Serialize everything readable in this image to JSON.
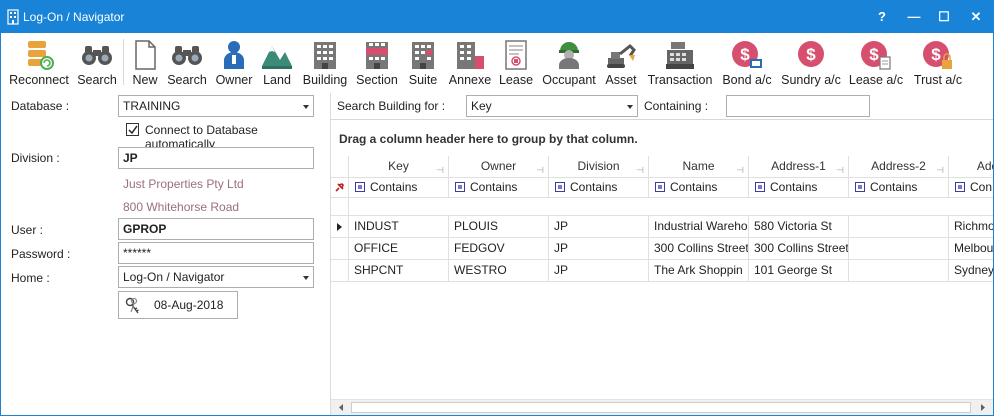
{
  "window": {
    "title": "Log-On / Navigator",
    "controls": {
      "help": "?",
      "minimize": "—",
      "maximize": "☐",
      "close": "✕"
    }
  },
  "toolbar": {
    "items": [
      {
        "label": "Reconnect",
        "icon": "database-reconnect-icon"
      },
      {
        "label": "Search",
        "icon": "binoculars-icon"
      },
      {
        "label": "New",
        "icon": "new-document-icon"
      },
      {
        "label": "Search",
        "icon": "binoculars-icon"
      },
      {
        "label": "Owner",
        "icon": "person-icon"
      },
      {
        "label": "Land",
        "icon": "land-icon"
      },
      {
        "label": "Building",
        "icon": "building-icon"
      },
      {
        "label": "Section",
        "icon": "section-icon"
      },
      {
        "label": "Suite",
        "icon": "suite-icon"
      },
      {
        "label": "Annexe",
        "icon": "annexe-icon"
      },
      {
        "label": "Lease",
        "icon": "lease-icon"
      },
      {
        "label": "Occupant",
        "icon": "occupant-icon"
      },
      {
        "label": "Asset",
        "icon": "asset-excavator-icon"
      },
      {
        "label": "Transaction",
        "icon": "cash-register-icon"
      },
      {
        "label": "Bond a/c",
        "icon": "bond-account-icon"
      },
      {
        "label": "Sundry a/c",
        "icon": "sundry-account-icon"
      },
      {
        "label": "Lease a/c",
        "icon": "lease-account-icon"
      },
      {
        "label": "Trust a/c",
        "icon": "trust-account-icon"
      }
    ]
  },
  "logon": {
    "database_label": "Database :",
    "database_value": "TRAINING",
    "auto_connect_label": "Connect to Database automatically",
    "auto_connect_checked": true,
    "division_label": "Division :",
    "division_value": "JP",
    "division_company": "Just Properties Pty Ltd",
    "division_address": "800 Whitehorse Road",
    "user_label": "User :",
    "user_value": "GPROP",
    "password_label": "Password :",
    "password_value": "******",
    "home_label": "Home :",
    "home_value": "Log-On / Navigator",
    "date_value": "08-Aug-2018"
  },
  "search": {
    "search_building_label": "Search Building for :",
    "search_building_value": "Key",
    "containing_label": "Containing :",
    "containing_value": ""
  },
  "grid": {
    "group_hint": "Drag a column header here to group by that column.",
    "columns": [
      "Key",
      "Owner",
      "Division",
      "Name",
      "Address-1",
      "Address-2",
      "Addr"
    ],
    "filter_label": "Contains",
    "filter_last_label": "Con",
    "rows": [
      {
        "key": "INDUST",
        "owner": "PLOUIS",
        "division": "JP",
        "name": "Industrial Wareho",
        "address1": "580 Victoria St",
        "address2": "",
        "address3": "Richmo"
      },
      {
        "key": "OFFICE",
        "owner": "FEDGOV",
        "division": "JP",
        "name": "300 Collins Street",
        "address1": "300 Collins Street",
        "address2": "",
        "address3": "Melbou"
      },
      {
        "key": "SHPCNT",
        "owner": "WESTRO",
        "division": "JP",
        "name": "The Ark Shoppin",
        "address1": "101 George St",
        "address2": "",
        "address3": "Sydney"
      }
    ]
  },
  "colors": {
    "titlebar": "#1883d7",
    "info_text": "#9a6f7f",
    "account_icon": "#d64f6e"
  }
}
